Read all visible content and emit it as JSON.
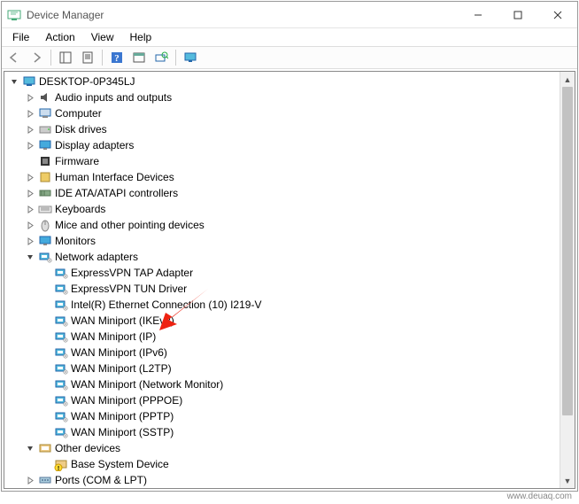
{
  "window": {
    "title": "Device Manager"
  },
  "menu": {
    "file": "File",
    "action": "Action",
    "view": "View",
    "help": "Help"
  },
  "tree": {
    "root": {
      "label": "DESKTOP-0P345LJ",
      "expanded": true
    },
    "categories": [
      {
        "label": "Audio inputs and outputs",
        "icon": "audio",
        "expanded": false
      },
      {
        "label": "Computer",
        "icon": "computer",
        "expanded": false
      },
      {
        "label": "Disk drives",
        "icon": "disk",
        "expanded": false
      },
      {
        "label": "Display adapters",
        "icon": "display",
        "expanded": false
      },
      {
        "label": "Firmware",
        "icon": "firmware",
        "expanded": false,
        "noexpander": true
      },
      {
        "label": "Human Interface Devices",
        "icon": "hid",
        "expanded": false
      },
      {
        "label": "IDE ATA/ATAPI controllers",
        "icon": "ide",
        "expanded": false
      },
      {
        "label": "Keyboards",
        "icon": "keyboard",
        "expanded": false
      },
      {
        "label": "Mice and other pointing devices",
        "icon": "mouse",
        "expanded": false
      },
      {
        "label": "Monitors",
        "icon": "monitor",
        "expanded": false
      },
      {
        "label": "Network adapters",
        "icon": "network",
        "expanded": true,
        "children": [
          {
            "label": "ExpressVPN TAP Adapter",
            "icon": "network"
          },
          {
            "label": "ExpressVPN TUN Driver",
            "icon": "network"
          },
          {
            "label": "Intel(R) Ethernet Connection (10) I219-V",
            "icon": "network"
          },
          {
            "label": "WAN Miniport (IKEv2)",
            "icon": "network"
          },
          {
            "label": "WAN Miniport (IP)",
            "icon": "network"
          },
          {
            "label": "WAN Miniport (IPv6)",
            "icon": "network"
          },
          {
            "label": "WAN Miniport (L2TP)",
            "icon": "network"
          },
          {
            "label": "WAN Miniport (Network Monitor)",
            "icon": "network"
          },
          {
            "label": "WAN Miniport (PPPOE)",
            "icon": "network"
          },
          {
            "label": "WAN Miniport (PPTP)",
            "icon": "network"
          },
          {
            "label": "WAN Miniport (SSTP)",
            "icon": "network"
          }
        ]
      },
      {
        "label": "Other devices",
        "icon": "other",
        "expanded": true,
        "children": [
          {
            "label": "Base System Device",
            "icon": "warn"
          }
        ]
      },
      {
        "label": "Ports (COM & LPT)",
        "icon": "ports",
        "expanded": false,
        "partial": true
      }
    ]
  },
  "watermark": "www.deuaq.com"
}
